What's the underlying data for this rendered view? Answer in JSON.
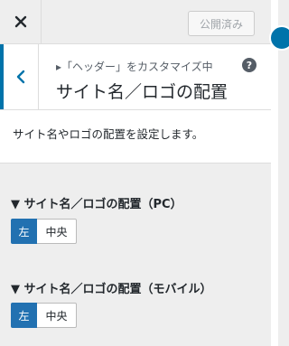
{
  "topbar": {
    "close_icon": "close-icon",
    "publish_label": "公開済み"
  },
  "section": {
    "back_icon": "chevron-left-icon",
    "breadcrumb": "▸「ヘッダー」をカスタマイズ中",
    "title": "サイト名／ロゴの配置",
    "help_icon": "help-icon",
    "help_glyph": "?",
    "description": "サイト名やロゴの配置を設定します。"
  },
  "controls": [
    {
      "label": "▼ サイト名／ロゴの配置（PC）",
      "options": [
        "左",
        "中央"
      ],
      "selected": "左"
    },
    {
      "label": "▼ サイト名／ロゴの配置（モバイル）",
      "options": [
        "左",
        "中央"
      ],
      "selected": "左"
    }
  ],
  "colors": {
    "accent": "#0073aa",
    "active_button": "#2271b1",
    "panel_bg": "#eeeeee"
  }
}
